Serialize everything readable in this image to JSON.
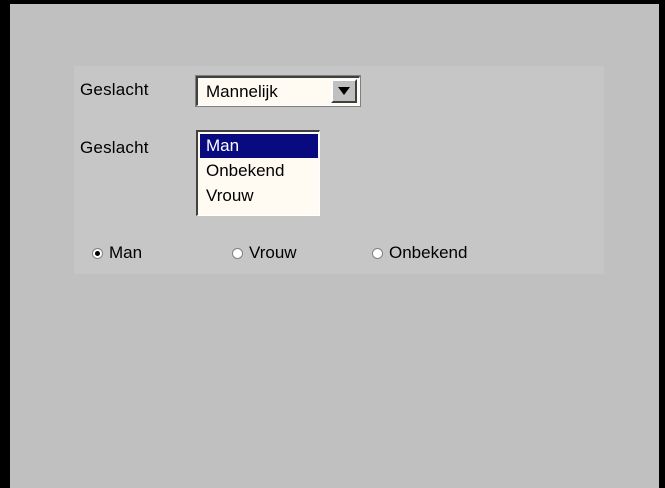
{
  "form": {
    "dropdown_label": "Geslacht",
    "dropdown_value": "Mannelijk",
    "listbox_label": "Geslacht",
    "listbox_items": [
      "Man",
      "Onbekend",
      "Vrouw"
    ],
    "listbox_selected_index": 0,
    "radios": [
      {
        "label": "Man",
        "checked": true
      },
      {
        "label": "Vrouw",
        "checked": false
      },
      {
        "label": "Onbekend",
        "checked": false
      }
    ]
  },
  "colors": {
    "background": "#c0c0c0",
    "selection": "#0a0a80",
    "field": "#fffbf2",
    "frame": "#000000"
  },
  "icons": {
    "dropdown_arrow": "chevron-down-icon"
  }
}
